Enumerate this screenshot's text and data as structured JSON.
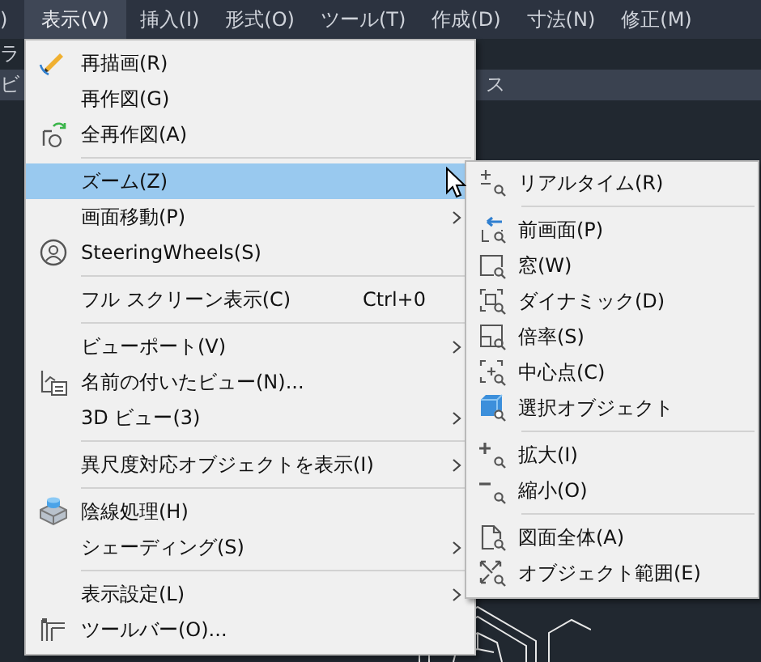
{
  "menu_bar": [
    {
      "label": ")",
      "selected": false
    },
    {
      "label": "表示(V)",
      "selected": true
    },
    {
      "label": "挿入(I)",
      "selected": false
    },
    {
      "label": "形式(O)",
      "selected": false
    },
    {
      "label": "ツール(T)",
      "selected": false
    },
    {
      "label": "作成(D)",
      "selected": false
    },
    {
      "label": "寸法(N)",
      "selected": false
    },
    {
      "label": "修正(M)",
      "selected": false
    }
  ],
  "background_fragments": [
    {
      "text": "ラ"
    },
    {
      "text": "ビ"
    },
    {
      "text": "ス"
    }
  ],
  "view_menu": [
    {
      "kind": "item",
      "label": "再描画(R)",
      "selected": false,
      "submenu": false
    },
    {
      "kind": "item",
      "label": "再作図(G)",
      "selected": false,
      "submenu": false
    },
    {
      "kind": "item",
      "label": "全再作図(A)",
      "selected": false,
      "submenu": false
    },
    {
      "kind": "separator"
    },
    {
      "kind": "item",
      "label": "ズーム(Z)",
      "selected": true,
      "submenu": false
    },
    {
      "kind": "item",
      "label": "画面移動(P)",
      "selected": false,
      "submenu": true
    },
    {
      "kind": "item",
      "label": "SteeringWheels(S)",
      "selected": false,
      "submenu": false
    },
    {
      "kind": "separator"
    },
    {
      "kind": "item",
      "label": "フル スクリーン表示(C)",
      "shortcut": "Ctrl+0",
      "selected": false,
      "submenu": false
    },
    {
      "kind": "separator"
    },
    {
      "kind": "item",
      "label": "ビューポート(V)",
      "selected": false,
      "submenu": true
    },
    {
      "kind": "item",
      "label": "名前の付いたビュー(N)...",
      "selected": false,
      "submenu": false
    },
    {
      "kind": "item",
      "label": "3D ビュー(3)",
      "selected": false,
      "submenu": true
    },
    {
      "kind": "separator"
    },
    {
      "kind": "item",
      "label": "異尺度対応オブジェクトを表示(I)",
      "selected": false,
      "submenu": true
    },
    {
      "kind": "separator"
    },
    {
      "kind": "item",
      "label": "陰線処理(H)",
      "selected": false,
      "submenu": false
    },
    {
      "kind": "item",
      "label": "シェーディング(S)",
      "selected": false,
      "submenu": true
    },
    {
      "kind": "separator"
    },
    {
      "kind": "item",
      "label": "表示設定(L)",
      "selected": false,
      "submenu": true
    },
    {
      "kind": "item",
      "label": "ツールバー(O)...",
      "selected": false,
      "submenu": false
    }
  ],
  "zoom_submenu": [
    {
      "kind": "item",
      "label": "リアルタイム(R)"
    },
    {
      "kind": "separator"
    },
    {
      "kind": "item",
      "label": "前画面(P)"
    },
    {
      "kind": "item",
      "label": "窓(W)"
    },
    {
      "kind": "item",
      "label": "ダイナミック(D)"
    },
    {
      "kind": "item",
      "label": "倍率(S)"
    },
    {
      "kind": "item",
      "label": "中心点(C)"
    },
    {
      "kind": "item",
      "label": "選択オブジェクト"
    },
    {
      "kind": "separator"
    },
    {
      "kind": "item",
      "label": "拡大(I)"
    },
    {
      "kind": "item",
      "label": "縮小(O)"
    },
    {
      "kind": "separator"
    },
    {
      "kind": "item",
      "label": "図面全体(A)"
    },
    {
      "kind": "item",
      "label": "オブジェクト範囲(E)"
    }
  ]
}
